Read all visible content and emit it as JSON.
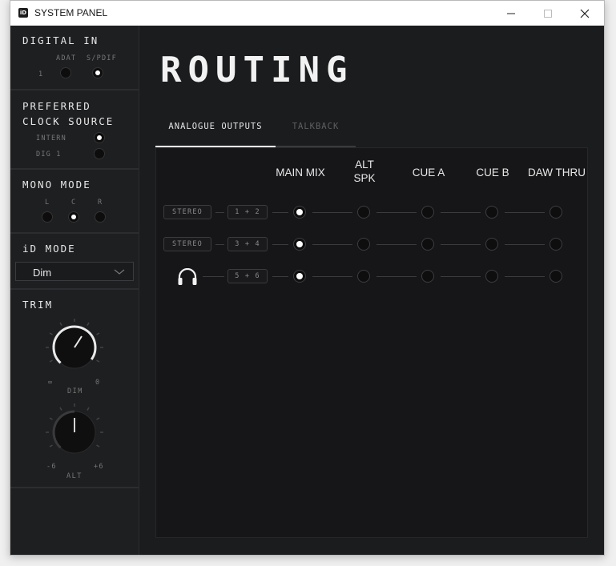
{
  "window": {
    "title": "SYSTEM PANEL",
    "app_icon_text": "iD"
  },
  "sidebar": {
    "digital_in": {
      "title": "DIGITAL IN",
      "row_label": "1",
      "options": [
        {
          "label": "ADAT",
          "selected": false
        },
        {
          "label": "S/PDIF",
          "selected": true
        }
      ]
    },
    "clock_source": {
      "title_line1": "PREFERRED",
      "title_line2": "CLOCK SOURCE",
      "options": [
        {
          "label": "INTERN",
          "selected": true
        },
        {
          "label": "DIG 1",
          "selected": false
        }
      ]
    },
    "mono_mode": {
      "title": "MONO MODE",
      "options": [
        {
          "label": "L",
          "selected": false
        },
        {
          "label": "C",
          "selected": true
        },
        {
          "label": "R",
          "selected": false
        }
      ]
    },
    "id_mode": {
      "title": "iD MODE",
      "selected": "Dim"
    },
    "trim": {
      "title": "TRIM",
      "dim_knob": {
        "label": "DIM",
        "min_label": "∞",
        "max_label": "0"
      },
      "alt_knob": {
        "label": "ALT",
        "min_label": "-6",
        "max_label": "+6"
      }
    }
  },
  "main": {
    "title": "ROUTING",
    "tabs": [
      {
        "label": "ANALOGUE OUTPUTS",
        "active": true
      },
      {
        "label": "TALKBACK",
        "active": false
      }
    ],
    "columns": [
      {
        "line1": "MAIN MIX",
        "line2": ""
      },
      {
        "line1": "ALT",
        "line2": "SPK"
      },
      {
        "line1": "CUE A",
        "line2": ""
      },
      {
        "line1": "CUE B",
        "line2": ""
      },
      {
        "line1": "DAW THRU",
        "line2": ""
      }
    ],
    "rows": [
      {
        "type": "STEREO",
        "channels": "1 + 2",
        "selected_column": 0
      },
      {
        "type": "STEREO",
        "channels": "3 + 4",
        "selected_column": 0
      },
      {
        "type": "headphones-icon",
        "channels": "5 + 6",
        "selected_column": 0
      }
    ]
  },
  "colors": {
    "background": "#1b1c1e",
    "accent": "#ffffff",
    "muted_text": "#777777"
  }
}
